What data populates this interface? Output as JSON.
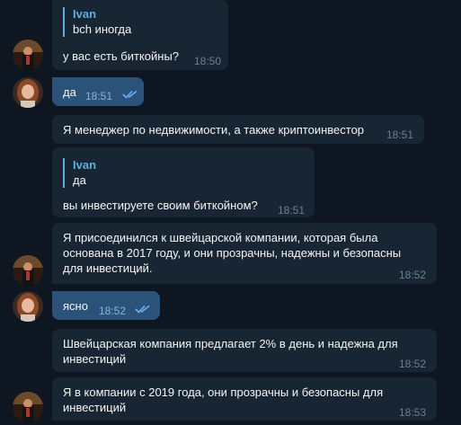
{
  "messages": [
    {
      "quote_name": "Ivan",
      "quote_text": "bch иногда",
      "text": "у вас есть биткойны?",
      "time": "18:50"
    },
    {
      "text": "да",
      "time": "18:51",
      "status": "read"
    },
    {
      "text": "Я менеджер по недвижимости, а также криптоинвестор",
      "time": "18:51"
    },
    {
      "quote_name": "Ivan",
      "quote_text": "да",
      "text": "вы инвестируете своим биткойном?",
      "time": "18:51"
    },
    {
      "lines": [
        "Я присоединился к швейцарской компании, которая была",
        "основана в 2017 году, и они прозрачны, надежны и безопасны",
        "для инвестиций."
      ],
      "time": "18:52"
    },
    {
      "text": "ясно",
      "time": "18:52",
      "status": "read"
    },
    {
      "lines": [
        "Швейцарская компания предлагает 2% в день и надежна для",
        "инвестиций"
      ],
      "time": "18:52"
    },
    {
      "lines": [
        "Я в компании с 2019 года, они прозрачны и безопасны для",
        "инвестиций"
      ],
      "time": "18:53"
    }
  ],
  "colors": {
    "background": "#0e1621",
    "incoming_bubble": "#182533",
    "outgoing_bubble": "#2b5278",
    "quote_accent": "#5eaedf",
    "read_check": "#6ab2f2"
  },
  "icons": {
    "read_status": "double-check-icon",
    "sender_avatar": "avatar-man-dark",
    "own_avatar": "avatar-woman"
  }
}
